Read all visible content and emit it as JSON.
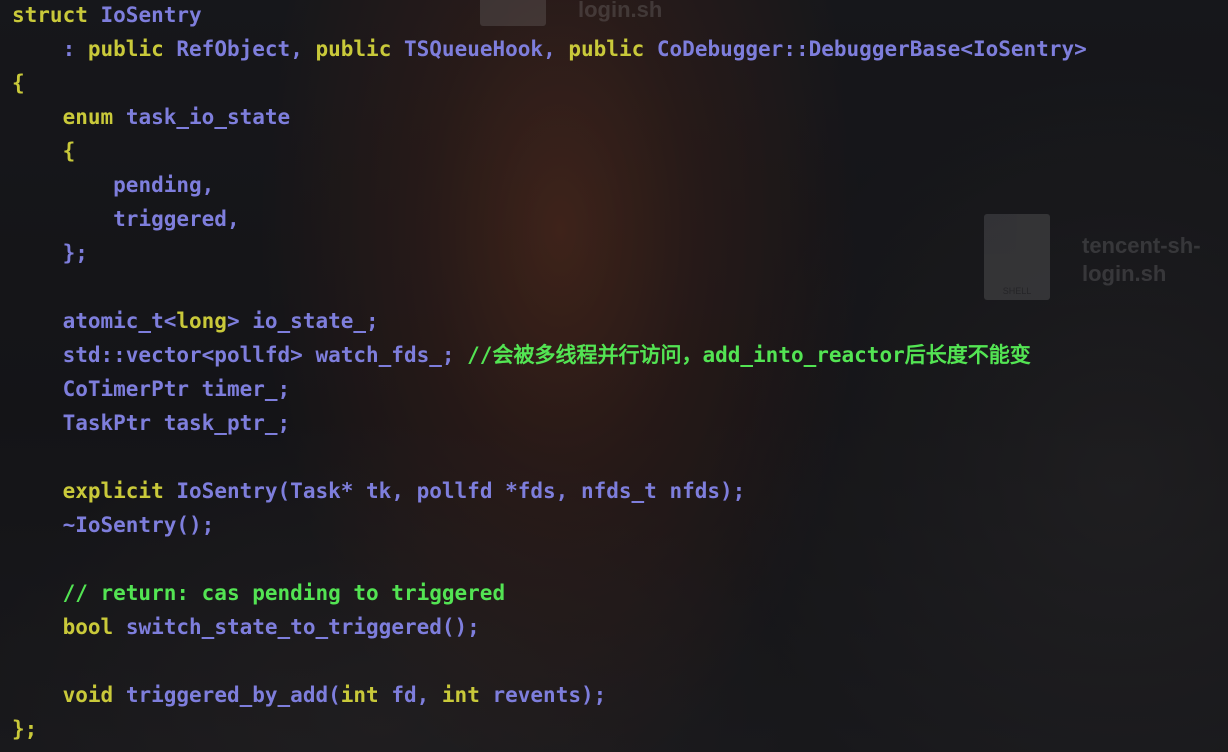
{
  "desktop": {
    "files": [
      {
        "name": "tencent-sh-\nlogin.sh",
        "icon": "shell-script-file-icon",
        "icon_label": ""
      },
      {
        "name": "tencent-sh-\nlogin.sh",
        "icon": "shell-script-file-icon",
        "icon_label": "SHELL"
      }
    ]
  },
  "colors": {
    "keyword": "#c9c93a",
    "identifier": "#7e7edc",
    "comment": "#53e453",
    "punctuation": "#7e7edc"
  },
  "code_lines": [
    [
      [
        "keyword",
        "struct"
      ],
      [
        "text",
        " "
      ],
      [
        "ident",
        "IoSentry"
      ]
    ],
    [
      [
        "text",
        "    "
      ],
      [
        "punct",
        ": "
      ],
      [
        "keyword",
        "public"
      ],
      [
        "text",
        " "
      ],
      [
        "ident",
        "RefObject"
      ],
      [
        "punct",
        ", "
      ],
      [
        "keyword",
        "public"
      ],
      [
        "text",
        " "
      ],
      [
        "ident",
        "TSQueueHook"
      ],
      [
        "punct",
        ", "
      ],
      [
        "keyword",
        "public"
      ],
      [
        "text",
        " "
      ],
      [
        "ident",
        "CoDebugger::DebuggerBase<IoSentry>"
      ]
    ],
    [
      [
        "keyword",
        "{"
      ]
    ],
    [
      [
        "text",
        "    "
      ],
      [
        "keyword",
        "enum"
      ],
      [
        "text",
        " "
      ],
      [
        "ident",
        "task_io_state"
      ]
    ],
    [
      [
        "text",
        "    "
      ],
      [
        "keyword",
        "{"
      ]
    ],
    [
      [
        "text",
        "        "
      ],
      [
        "ident",
        "pending,"
      ]
    ],
    [
      [
        "text",
        "        "
      ],
      [
        "ident",
        "triggered,"
      ]
    ],
    [
      [
        "text",
        "    "
      ],
      [
        "ident",
        "};"
      ]
    ],
    [],
    [
      [
        "text",
        "    "
      ],
      [
        "ident",
        "atomic_t<"
      ],
      [
        "keyword",
        "long"
      ],
      [
        "ident",
        "> io_state_;"
      ]
    ],
    [
      [
        "text",
        "    "
      ],
      [
        "ident",
        "std::vector<pollfd> watch_fds_; "
      ],
      [
        "comment",
        "//会被多线程并行访问，add_into_reactor后长度不能变"
      ]
    ],
    [
      [
        "text",
        "    "
      ],
      [
        "ident",
        "CoTimerPtr timer_;"
      ]
    ],
    [
      [
        "text",
        "    "
      ],
      [
        "ident",
        "TaskPtr task_ptr_;"
      ]
    ],
    [],
    [
      [
        "text",
        "    "
      ],
      [
        "keyword",
        "explicit"
      ],
      [
        "text",
        " "
      ],
      [
        "ident",
        "IoSentry(Task* tk, pollfd *fds, nfds_t nfds);"
      ]
    ],
    [
      [
        "text",
        "    "
      ],
      [
        "ident",
        "~IoSentry();"
      ]
    ],
    [],
    [
      [
        "text",
        "    "
      ],
      [
        "comment",
        "// return: cas pending to triggered"
      ]
    ],
    [
      [
        "text",
        "    "
      ],
      [
        "keyword",
        "bool"
      ],
      [
        "text",
        " "
      ],
      [
        "ident",
        "switch_state_to_triggered();"
      ]
    ],
    [],
    [
      [
        "text",
        "    "
      ],
      [
        "keyword",
        "void"
      ],
      [
        "text",
        " "
      ],
      [
        "ident",
        "triggered_by_add("
      ],
      [
        "keyword",
        "int"
      ],
      [
        "ident",
        " fd, "
      ],
      [
        "keyword",
        "int"
      ],
      [
        "ident",
        " revents);"
      ]
    ],
    [
      [
        "keyword",
        "};"
      ]
    ]
  ]
}
